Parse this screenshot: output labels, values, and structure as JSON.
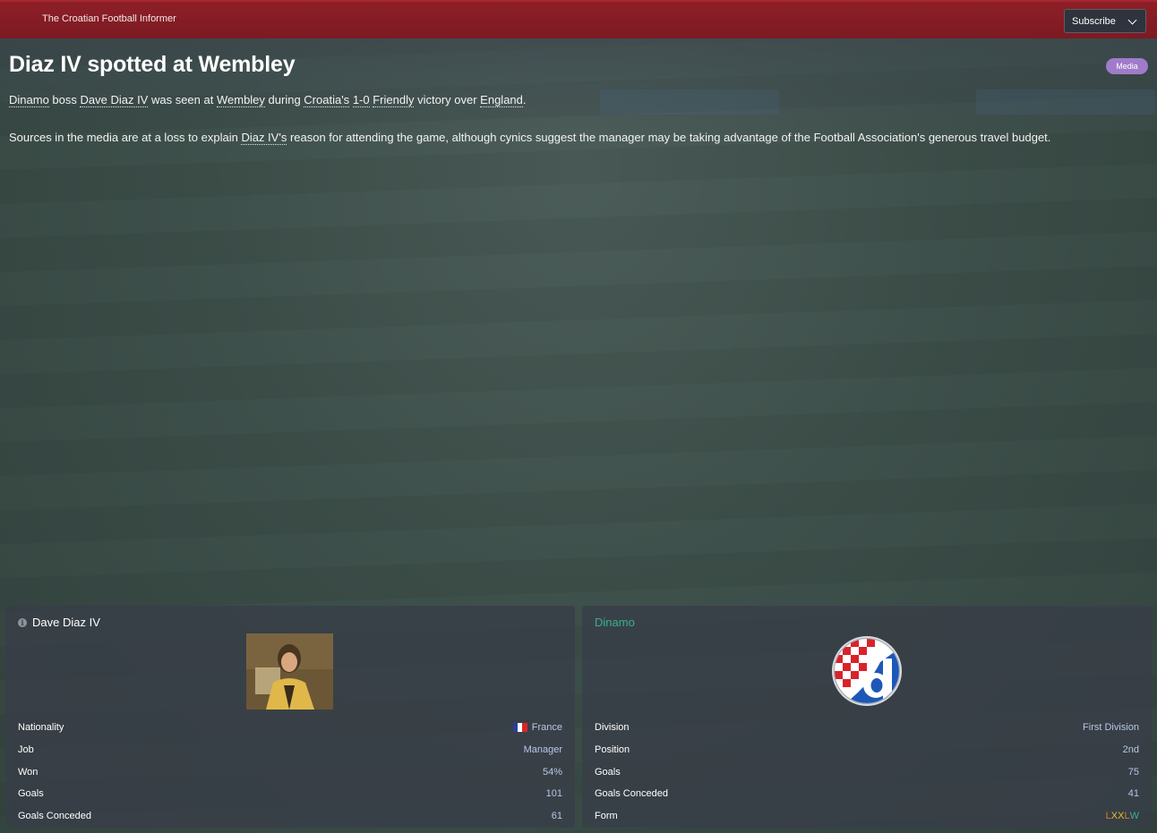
{
  "publication": {
    "name": "The Croatian Football Informer",
    "subscribe_label": "Subscribe"
  },
  "article": {
    "headline": "Diaz IV spotted at Wembley",
    "badge": "Media",
    "p1": {
      "club": "Dinamo",
      "t1": " boss ",
      "manager": "Dave Diaz IV",
      "t2": " was seen at ",
      "venue": "Wembley",
      "t3": " during ",
      "country": "Croatia's",
      "t4": " ",
      "score": "1-0",
      "t5": " ",
      "match_type": "Friendly",
      "t6": " victory over ",
      "opponent": "England",
      "t7": "."
    },
    "p2": {
      "t1": "Sources in the media are at a loss to explain ",
      "manager": "Diaz IV's",
      "t2": " reason for attending the game, although cynics suggest the manager may be taking advantage of the Football Association's generous travel budget."
    }
  },
  "manager_panel": {
    "title": "Dave Diaz IV",
    "rows": [
      {
        "label": "Nationality",
        "value": "France"
      },
      {
        "label": "Job",
        "value": "Manager"
      },
      {
        "label": "Won",
        "value": "54%"
      },
      {
        "label": "Goals",
        "value": "101"
      },
      {
        "label": "Goals Conceded",
        "value": "61"
      }
    ]
  },
  "club_panel": {
    "title": "Dinamo",
    "rows": [
      {
        "label": "Division",
        "value": "First Division"
      },
      {
        "label": "Position",
        "value": "2nd"
      },
      {
        "label": "Goals",
        "value": "75"
      },
      {
        "label": "Goals Conceded",
        "value": "41"
      },
      {
        "label": "Form",
        "value": "LXXLW"
      }
    ],
    "form": [
      "L",
      "X",
      "X",
      "L",
      "W"
    ]
  },
  "colors": {
    "topbar": "#8e1f27",
    "badge": "#a07bc9",
    "club_accent": "#3bb08a",
    "value_text": "#b9c6e8"
  }
}
